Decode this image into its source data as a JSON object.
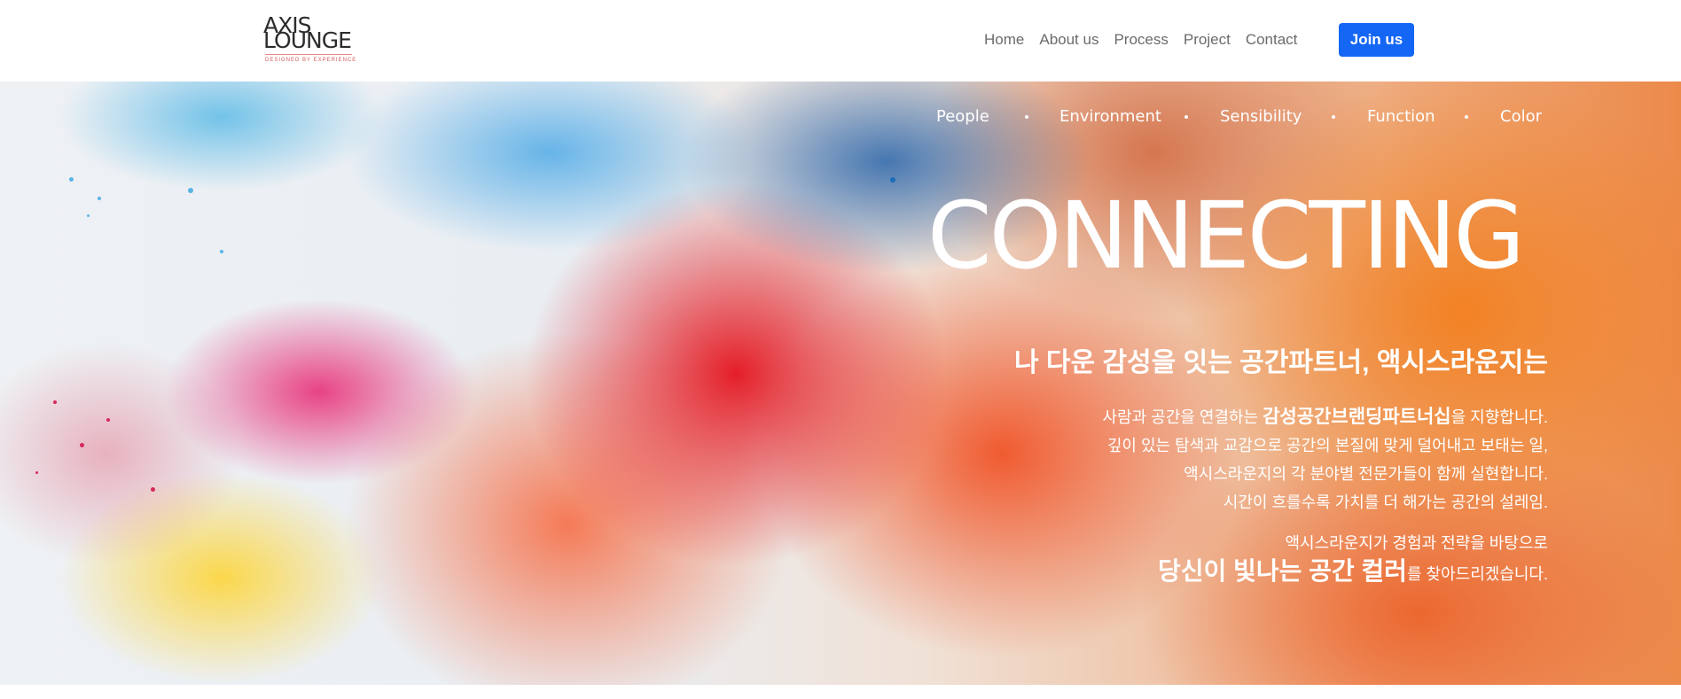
{
  "header": {
    "logo": {
      "line1": "AXIS",
      "line2": "LOUNGE",
      "tagline": "DESIGNED BY EXPERIENCE"
    },
    "nav": [
      "Home",
      "About us",
      "Process",
      "Project",
      "Contact"
    ],
    "join_label": "Join us",
    "accent_color": "#1466f5"
  },
  "hero": {
    "tags": [
      "People",
      "Environment",
      "Sensibility",
      "Function",
      "Color"
    ],
    "title": "CONNECTING",
    "subtitle": "나 다운 감성을 잇는 공간파트너, 액시스라운지는",
    "body": {
      "p1_prefix": "사람과 공간을 연결하는 ",
      "p1_strong": "감성공간브랜딩파트너십",
      "p1_suffix": "을 지향합니다.",
      "p2": "깊이 있는 탐색과 교감으로 공간의 본질에 맞게 덜어내고 보태는 일,",
      "p3": "액시스라운지의 각 분야별 전문가들이 함께 실현합니다.",
      "p4": "시간이 흐를수록 가치를 더 해가는 공간의 설레임.",
      "p5": "액시스라운지가 경험과 전략을 바탕으로",
      "p6_strong": "당신이 빛나는 공간 컬러",
      "p6_suffix": "를 찾아드리겠습니다."
    }
  }
}
